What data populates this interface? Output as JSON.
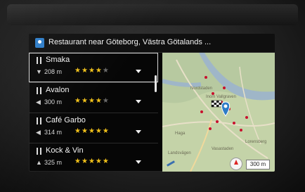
{
  "header": {
    "title": "Restaurant near Göteborg, Västra Götalands ..."
  },
  "results": [
    {
      "name": "Smaka",
      "distance": "208 m",
      "rating": 4,
      "selected": true,
      "direction_icon": "arrow-down-left-icon"
    },
    {
      "name": "Avalon",
      "distance": "300 m",
      "rating": 4,
      "selected": false,
      "direction_icon": "arrow-left-icon"
    },
    {
      "name": "Café Garbo",
      "distance": "314 m",
      "rating": 5,
      "selected": false,
      "direction_icon": "arrow-left-icon"
    },
    {
      "name": "Kock & Vin",
      "distance": "325 m",
      "rating": 5,
      "selected": false,
      "direction_icon": "arrow-up-icon"
    }
  ],
  "map": {
    "labels": [
      "Nordstaden",
      "Inom Vallgraven",
      "Haga",
      "Lorensberg",
      "Vasastaden",
      "Landsvägen"
    ],
    "scale_label": "300 m"
  },
  "colors": {
    "accent": "#2d7cc7",
    "star_on": "#f2c21a",
    "star_off": "#6a6a6a",
    "map_land": "#c4d3a8",
    "map_water": "#9fb6c8",
    "poi": "#c8102e"
  }
}
